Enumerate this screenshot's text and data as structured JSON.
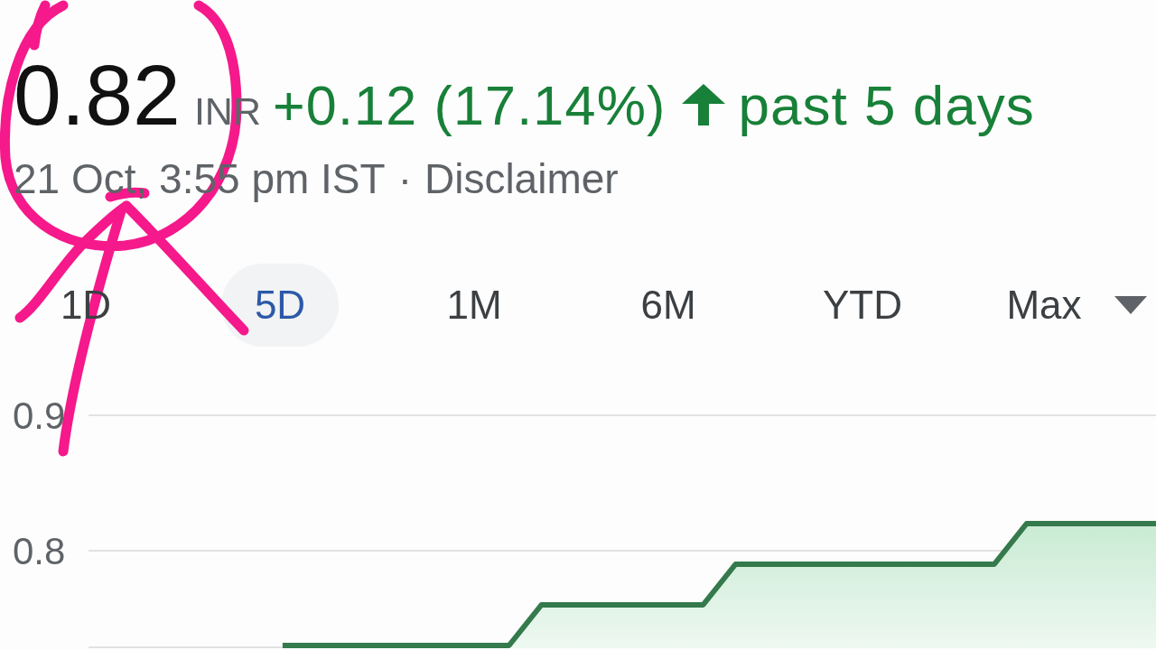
{
  "quote": {
    "price": "0.82",
    "currency": "INR",
    "change": "+0.12 (17.14%)",
    "period": "past 5 days",
    "timestamp": "21 Oct, 3:55 pm IST",
    "separator": "·",
    "disclaimer_link": "Disclaimer"
  },
  "range_tabs": [
    {
      "label": "1D",
      "selected": false
    },
    {
      "label": "5D",
      "selected": true
    },
    {
      "label": "1M",
      "selected": false
    },
    {
      "label": "6M",
      "selected": false
    },
    {
      "label": "YTD",
      "selected": false
    },
    {
      "label": "Max",
      "selected": false
    }
  ],
  "chart": {
    "chart_data": [
      {
        "type": "area",
        "categories": [
          null,
          null,
          null,
          null,
          null,
          null,
          null,
          null,
          null,
          null,
          null,
          null,
          null,
          null,
          null,
          null,
          null,
          null,
          null,
          null,
          null,
          null,
          null,
          null,
          null,
          null,
          null,
          null,
          null,
          null,
          null,
          null,
          null,
          null
        ],
        "values": [
          null,
          null,
          null,
          null,
          null,
          null,
          0.73,
          0.73,
          0.73,
          0.73,
          0.73,
          0.73,
          0.73,
          0.73,
          0.76,
          0.76,
          0.76,
          0.76,
          0.76,
          0.76,
          0.79,
          0.79,
          0.79,
          0.79,
          0.79,
          0.79,
          0.79,
          0.79,
          0.79,
          0.82,
          0.82,
          0.82,
          0.82,
          0.82
        ],
        "color": "#357a4c",
        "ylim": [
          0.728,
          0.9
        ],
        "yticks": [
          0.9,
          0.8
        ],
        "grid": true
      }
    ]
  }
}
